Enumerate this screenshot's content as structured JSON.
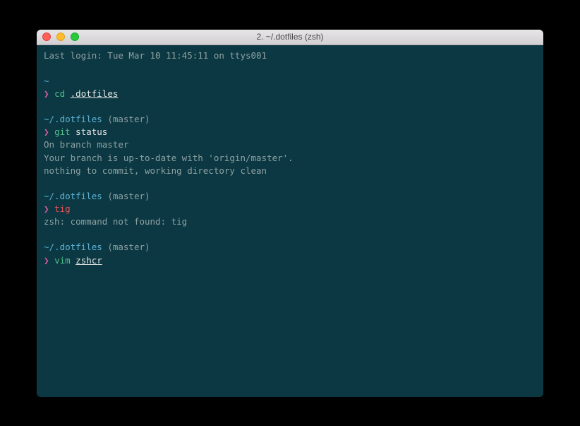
{
  "window": {
    "title": "2. ~/.dotfiles (zsh)"
  },
  "colors": {
    "bg": "#0b3842",
    "path": "#5fb3d9",
    "prompt": "#e05b9f",
    "green": "#4fc08d",
    "red": "#e9545d"
  },
  "terminal": {
    "login_line": "Last login: Tue Mar 10 11:45:11 on ttys001",
    "block1": {
      "path": "~",
      "prompt": "❯",
      "cmd": "cd",
      "arg": ".dotfiles"
    },
    "block2": {
      "path": "~/.dotfiles",
      "branch": "(master)",
      "prompt": "❯",
      "cmd": "git",
      "arg": "status",
      "out1": "On branch master",
      "out2": "Your branch is up-to-date with 'origin/master'.",
      "out3": "nothing to commit, working directory clean"
    },
    "block3": {
      "path": "~/.dotfiles",
      "branch": "(master)",
      "prompt": "❯",
      "cmd": "tig",
      "out1": "zsh: command not found: tig"
    },
    "block4": {
      "path": "~/.dotfiles",
      "branch": "(master)",
      "prompt": "❯",
      "cmd": "vim",
      "arg": "zshcr"
    }
  }
}
